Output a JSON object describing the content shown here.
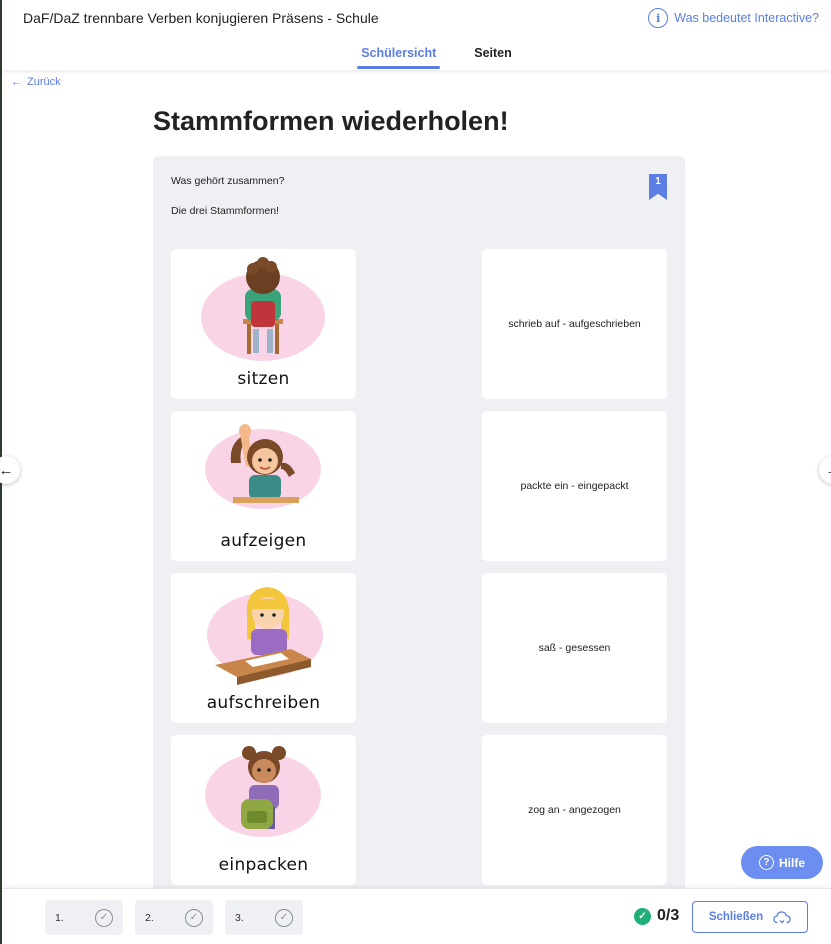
{
  "header": {
    "app_title": "DaF/DaZ trennbare Verben konjugieren Präsens - Schule",
    "info_link": "Was bedeutet Interactive?",
    "info_icon": "i",
    "tabs": [
      {
        "label": "Schülersicht",
        "active": true
      },
      {
        "label": "Seiten",
        "active": false
      }
    ]
  },
  "nav": {
    "back_label": "Zurück",
    "back_icon": "←",
    "prev_icon": "←",
    "next_icon": "→"
  },
  "page": {
    "heading": "Stammformen wiederholen!"
  },
  "exercise": {
    "question": "Was gehört zusammen?",
    "instruction": "Die drei Stammformen!",
    "bookmark_number": "1",
    "image_cards": [
      {
        "label": "sitzen",
        "icon": "child-sitting-at-desk"
      },
      {
        "label": "aufzeigen",
        "icon": "child-raising-hand"
      },
      {
        "label": "aufschreiben",
        "icon": "child-writing"
      },
      {
        "label": "einpacken",
        "icon": "child-packing-bag"
      }
    ],
    "text_cards": [
      {
        "label": "schrieb auf - aufgeschrieben"
      },
      {
        "label": "packte ein - eingepackt"
      },
      {
        "label": "saß - gesessen"
      },
      {
        "label": "zog an - angezogen"
      }
    ]
  },
  "help_button": {
    "label": "Hilfe",
    "icon": "?"
  },
  "footer": {
    "steps": [
      {
        "label": "1.",
        "status": "check"
      },
      {
        "label": "2.",
        "status": "check"
      },
      {
        "label": "3.",
        "status": "check"
      }
    ],
    "score": "0/3",
    "score_icon": "✓",
    "close_label": "Schließen"
  },
  "colors": {
    "accent": "#5b7ee5",
    "panel_bg": "#eef0f4",
    "success": "#1fb07a"
  }
}
